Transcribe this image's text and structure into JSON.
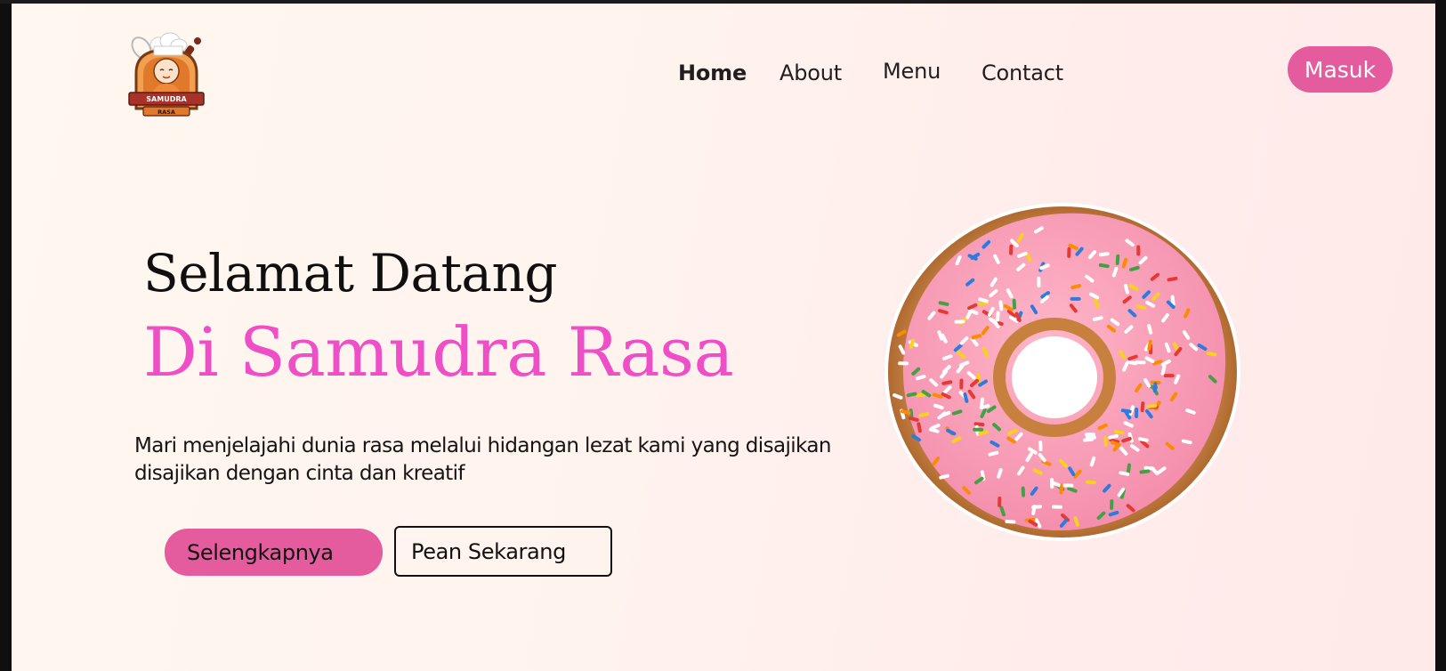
{
  "brand": {
    "logo_icon": "chef-mascot-logo-icon",
    "logo_text_line1": "SAMUDRA",
    "logo_text_line2": "RASA"
  },
  "nav": {
    "items": [
      {
        "label": "Home",
        "active": true
      },
      {
        "label": "About",
        "active": false
      },
      {
        "label": "Menu",
        "active": false
      },
      {
        "label": "Contact",
        "active": false
      }
    ]
  },
  "header": {
    "login_label": "Masuk"
  },
  "hero": {
    "title_line1": "Selamat Datang",
    "title_line2": "Di Samudra Rasa",
    "description": "Mari menjelajahi dunia rasa melalui hidangan lezat kami yang disajikan disajikan dengan cinta dan kreatif",
    "primary_button": "Selengkapnya",
    "secondary_button": "Pean Sekarang",
    "image_icon": "pink-sprinkle-donut-icon"
  },
  "colors": {
    "accent_pink": "#e45c9d",
    "title_pink": "#ef4fc6",
    "background": "#fff5ef"
  }
}
